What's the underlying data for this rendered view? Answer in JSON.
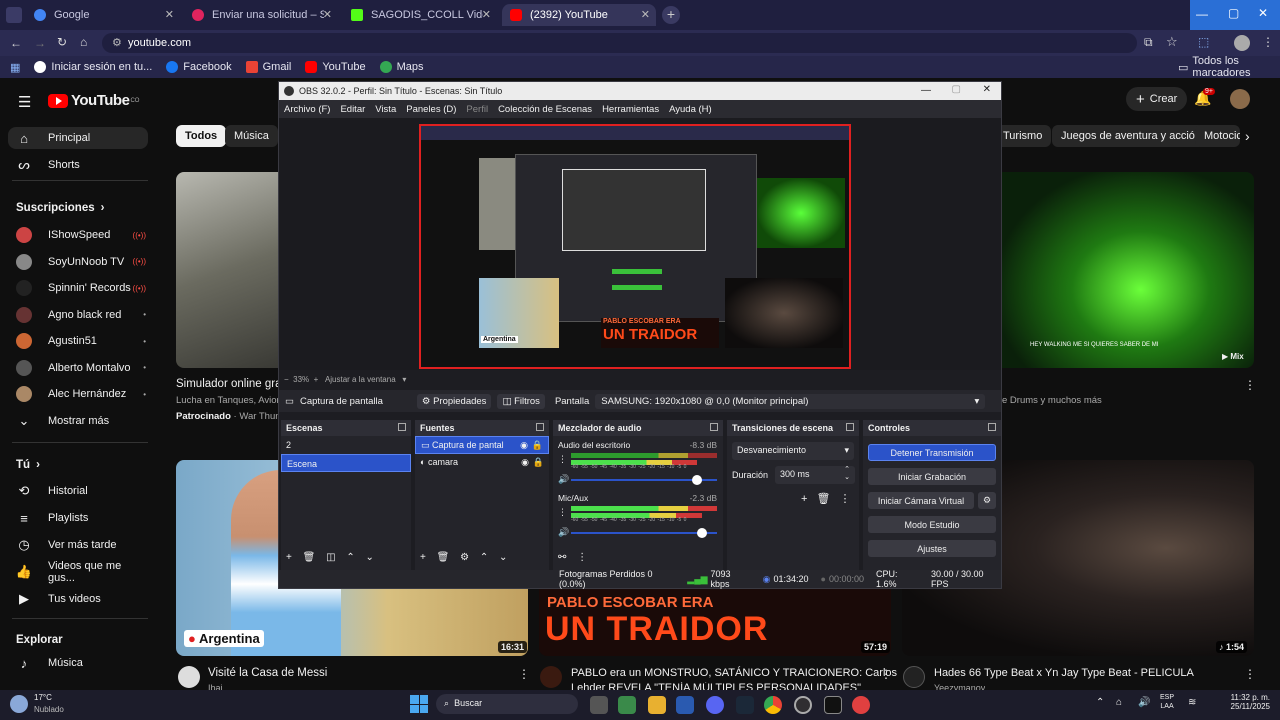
{
  "browser": {
    "tabs": [
      {
        "title": "Google",
        "color": "#4285f4"
      },
      {
        "title": "Enviar una solicitud – Soporte d",
        "color": "#e0245e"
      },
      {
        "title": "SAGODIS_CCOLL Videos - Web",
        "color": "#53fc18"
      },
      {
        "title": "(2392) YouTube",
        "color": "#ff0000"
      }
    ],
    "url": "youtube.com",
    "bookmarks": [
      "Iniciar sesión en tu...",
      "Facebook",
      "Gmail",
      "YouTube",
      "Maps"
    ],
    "all_bookmarks": "Todos los marcadores"
  },
  "youtube": {
    "logo": "YouTube",
    "logo_sup": "CO",
    "create": "Crear",
    "notif_count": "9+",
    "nav": [
      "Principal",
      "Shorts"
    ],
    "subs_header": "Suscripciones",
    "channels": [
      {
        "name": "IShowSpeed",
        "live": true,
        "color": "#c44"
      },
      {
        "name": "SoyUnNoob TV",
        "live": true,
        "color": "#888"
      },
      {
        "name": "Spinnin' Records",
        "live": true,
        "color": "#222"
      },
      {
        "name": "Agno black red",
        "live": false,
        "color": "#633"
      },
      {
        "name": "Agustin51",
        "live": false,
        "color": "#c63"
      },
      {
        "name": "Alberto Montalvo",
        "live": false,
        "color": "#555"
      },
      {
        "name": "Alec Hernández",
        "live": false,
        "color": "#a86"
      }
    ],
    "show_more": "Mostrar más",
    "you_header": "Tú",
    "you_items": [
      "Historial",
      "Playlists",
      "Ver más tarde",
      "Videos que me gus...",
      "Tus videos"
    ],
    "explore_header": "Explorar",
    "explore_items": [
      "Música"
    ],
    "chips": [
      "Todos",
      "Música"
    ],
    "chips_right": [
      "Turismo",
      "Juegos de aventura y acción",
      "Motocicl"
    ],
    "videos": {
      "v1_title": "Simulador online grat",
      "v1_sub": "Lucha en Tanques, Avion",
      "v1_sponsored": "Patrocinado",
      "v1_sponsor": "· War Thund",
      "v2_overlay": "HEY WALKING ME SI QUIERES SABER DE MI",
      "v2_mix": "Mix",
      "v2_sub": "e Drums y muchos más",
      "v3_title": "Visité la Casa de Messi",
      "v3_tag": "Argentina",
      "v3_dur": "16:31",
      "v3_channel": "Ibai",
      "v4_title": "PABLO era un MONSTRUO, SATÁNICO Y TRAICIONERO: Carlos",
      "v4_title2": "Lehder REVELA \"TENÍA MÚLTIPLES PERSONALIDADES\"",
      "v4_overlay1": "PABLO ESCOBAR ERA",
      "v4_overlay2": "UN TRAIDOR",
      "v4_dur": "57:19",
      "v5_title": "Hades 66 Type Beat x Yn Jay Type Beat - PELICULA",
      "v5_dur": "1:54",
      "v5_channel": "Yeezymanoy"
    }
  },
  "obs": {
    "title": "OBS 32.0.2 - Perfil: Sin Título - Escenas: Sin Título",
    "menu": [
      "Archivo (F)",
      "Editar",
      "Vista",
      "Paneles (D)",
      "Perfil",
      "Colección de Escenas",
      "Herramientas",
      "Ayuda (H)"
    ],
    "zoom": "33%",
    "fit": "Ajustar a la ventana",
    "source_name": "Captura de pantalla",
    "properties": "Propiedades",
    "filters": "Filtros",
    "display_label": "Pantalla",
    "display_value": "SAMSUNG: 1920x1080 @ 0,0 (Monitor principal)",
    "docks": {
      "scenes": "Escenas",
      "sources": "Fuentes",
      "mixer": "Mezclador de audio",
      "transitions": "Transiciones de escena",
      "controls": "Controles"
    },
    "scenes": [
      "2",
      "Escena"
    ],
    "sources": [
      "Captura de pantal",
      "camara"
    ],
    "audio": [
      {
        "name": "Audio del escritorio",
        "db": "-8.3 dB",
        "level": 0.86
      },
      {
        "name": "Mic/Aux",
        "db": "-2.3 dB",
        "level": 0.9
      }
    ],
    "meter_ticks": "-60 -55 -50 -45 -40 -35 -30 -25 -20 -15 -10 -5 0",
    "transition": "Desvanecimiento",
    "duration_label": "Duración",
    "duration_value": "300 ms",
    "controls": [
      "Detener Transmisión",
      "Iniciar Grabación",
      "Iniciar Cámara Virtual",
      "Modo Estudio",
      "Ajustes"
    ],
    "status": {
      "dropped": "Fotogramas Perdidos 0 (0.0%)",
      "kbps": "7093 kbps",
      "live_time": "01:34:20",
      "rec_time": "00:00:00",
      "cpu": "CPU: 1.6%",
      "fps": "30.00 / 30.00 FPS"
    },
    "preview_overlay1": "PABLO ESCOBAR ERA",
    "preview_overlay2": "UN TRAIDOR",
    "preview_tag": "Argentina"
  },
  "taskbar": {
    "weather_temp": "17°C",
    "weather_desc": "Nublado",
    "search": "Buscar",
    "lang": "ESP",
    "lang2": "LAA",
    "time": "11:32 p. m.",
    "date": "25/11/2025"
  }
}
